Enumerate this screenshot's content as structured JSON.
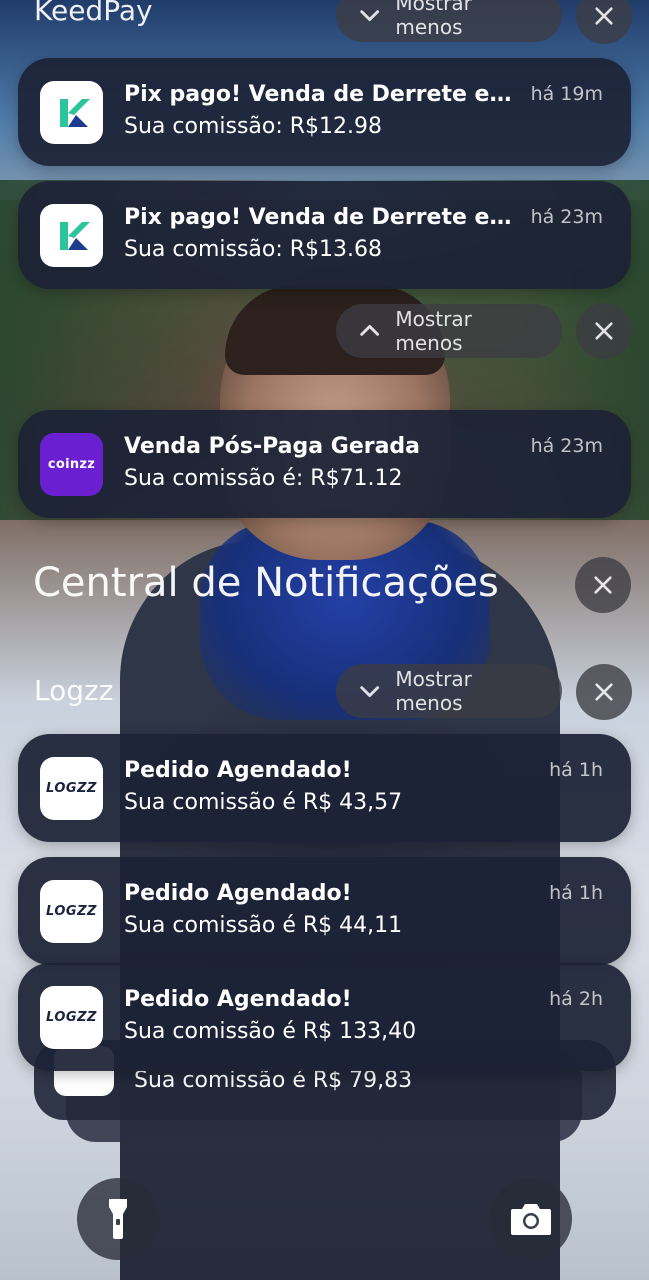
{
  "groups": {
    "keedpay": {
      "title": "KeedPay",
      "collapse_label": "Mostrar menos",
      "notifications": [
        {
          "title": "Pix pago! Venda de Derrete e S...",
          "body": "Sua comissão: R$12.98",
          "time": "há 19m"
        },
        {
          "title": "Pix pago! Venda de Derrete e S...",
          "body": "Sua comissão: R$13.68",
          "time": "há 23m"
        }
      ]
    },
    "coinzz": {
      "collapse_label": "Mostrar menos",
      "app_icon_text": "coinzz",
      "notifications": [
        {
          "title": "Venda Pós-Paga Gerada",
          "body": "Sua comissão é: R$71.12",
          "time": "há 23m"
        }
      ]
    },
    "center": {
      "title": "Central de Notificações"
    },
    "logzz": {
      "title": "Logzz",
      "collapse_label": "Mostrar menos",
      "app_icon_text": "LOGZZ",
      "notifications": [
        {
          "title": "Pedido Agendado!",
          "body": "Sua comissão é R$ 43,57",
          "time": "há 1h"
        },
        {
          "title": "Pedido Agendado!",
          "body": "Sua comissão é R$ 44,11",
          "time": "há 1h"
        },
        {
          "title": "Pedido Agendado!",
          "body": "Sua comissão é R$ 133,40",
          "time": "há 2h"
        }
      ],
      "stacked_body": "Sua comissão é R$ 79,83"
    }
  },
  "icons": {
    "flashlight": "flashlight-icon",
    "camera": "camera-icon",
    "close": "close-icon",
    "chevron_down": "chevron-down-icon",
    "chevron_up": "chevron-up-icon"
  },
  "colors": {
    "card_bg": "#1c2236",
    "keedpay_green": "#2ac59a",
    "coinzz_purple": "#6a1fd1",
    "logzz_green": "#19c37d"
  }
}
